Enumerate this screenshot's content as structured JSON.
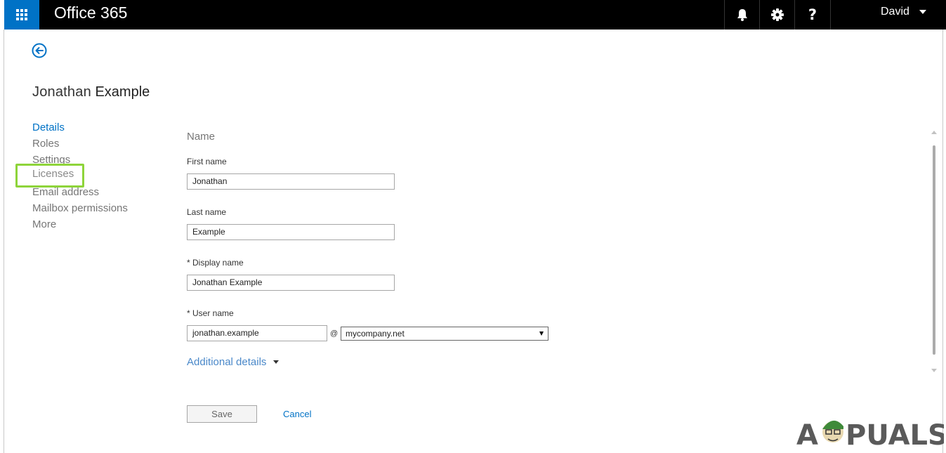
{
  "header": {
    "app_title": "Office 365",
    "user_name": "David",
    "help_glyph": "?",
    "icons": [
      "app-launcher-icon",
      "bell-icon",
      "gear-icon",
      "help-icon",
      "chevron-down-icon"
    ]
  },
  "page": {
    "first_name": "Jonathan",
    "last_name": "Example"
  },
  "side_nav": {
    "items": [
      "Details",
      "Roles",
      "Settings",
      "Licenses",
      "Email address",
      "Mailbox permissions",
      "More"
    ],
    "active": "Details",
    "highlighted": "Licenses"
  },
  "form": {
    "section_title": "Name",
    "first_name_label": "First name",
    "first_name_value": "Jonathan",
    "last_name_label": "Last name",
    "last_name_value": "Example",
    "display_name_label": "* Display name",
    "display_name_value": "Jonathan Example",
    "user_name_label": "* User name",
    "user_name_value": "jonathan.example",
    "at_symbol": "@",
    "domain_value": "mycompany.net",
    "additional_details": "Additional details",
    "save": "Save",
    "cancel": "Cancel"
  },
  "watermark": {
    "text_a": "A",
    "text_rest": "PUALS"
  },
  "colors": {
    "brand_blue": "#0072c6",
    "highlight_green": "#8ed43a",
    "topbar": "#000000"
  }
}
